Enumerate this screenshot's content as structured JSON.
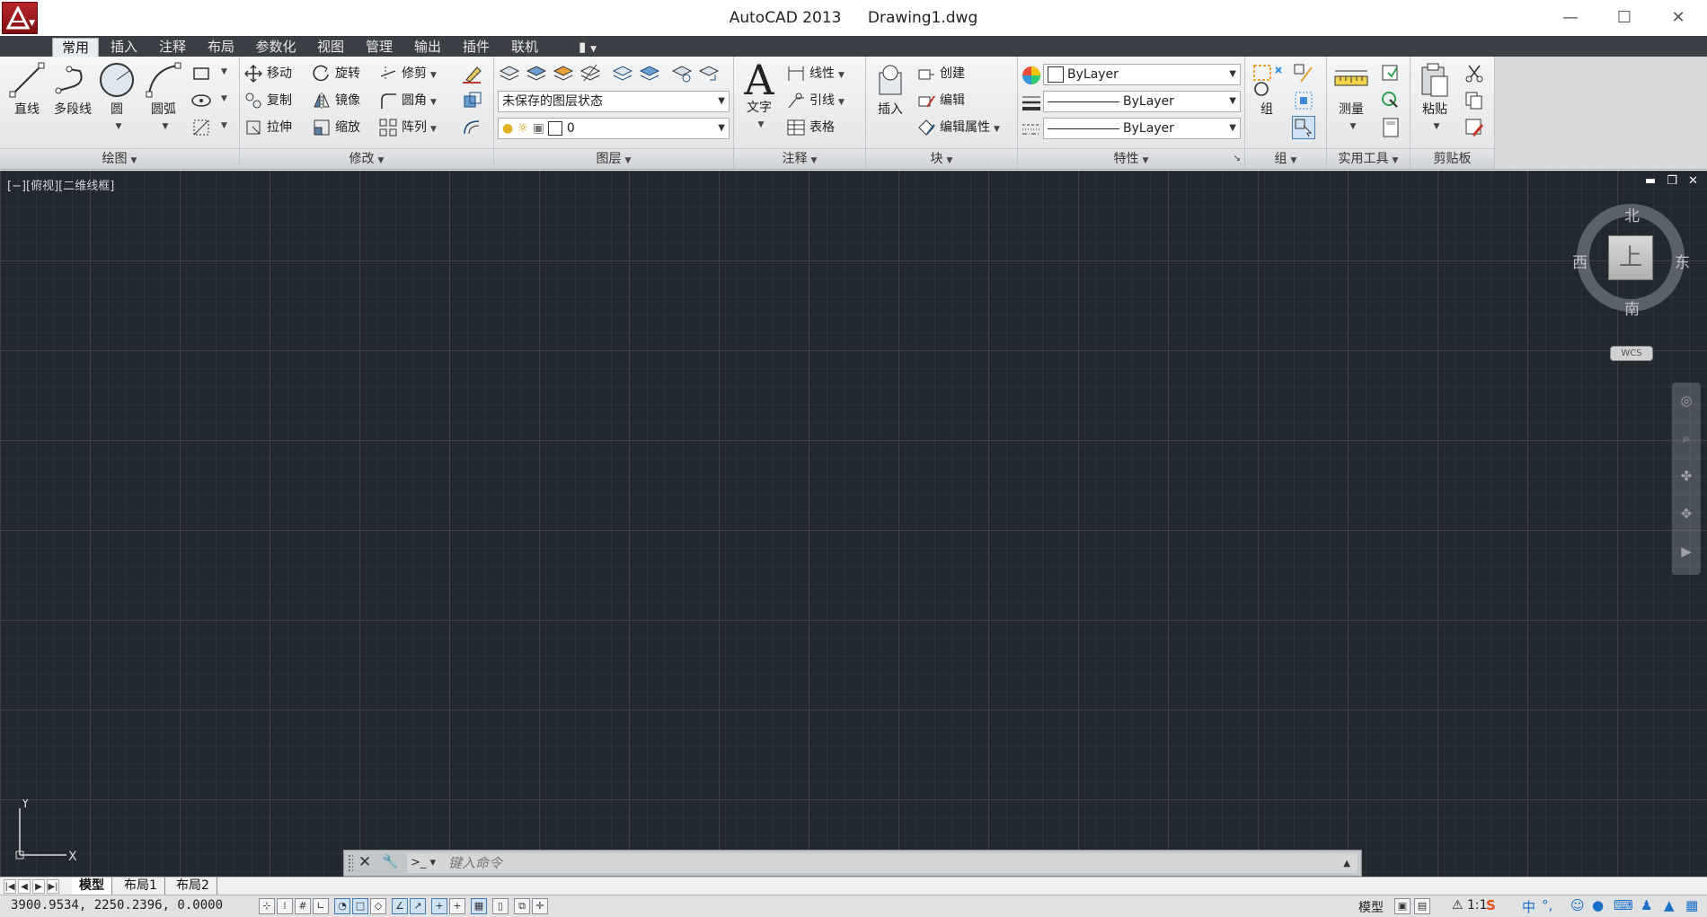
{
  "titlebar": {
    "app": "AutoCAD 2013",
    "file": "Drawing1.dwg"
  },
  "tabs": [
    {
      "label": "常用",
      "active": true
    },
    {
      "label": "插入"
    },
    {
      "label": "注释"
    },
    {
      "label": "布局"
    },
    {
      "label": "参数化"
    },
    {
      "label": "视图"
    },
    {
      "label": "管理"
    },
    {
      "label": "输出"
    },
    {
      "label": "插件"
    },
    {
      "label": "联机"
    }
  ],
  "ribbon": {
    "draw": {
      "title": "绘图",
      "line": "直线",
      "polyline": "多段线",
      "circle": "圆",
      "arc": "圆弧"
    },
    "modify": {
      "title": "修改",
      "move": "移动",
      "rotate": "旋转",
      "trim": "修剪",
      "copy": "复制",
      "mirror": "镜像",
      "fillet": "圆角",
      "stretch": "拉伸",
      "scale": "缩放",
      "array": "阵列"
    },
    "layers": {
      "title": "图层",
      "state": "未保存的图层状态",
      "current": "0"
    },
    "annotation": {
      "title": "注释",
      "text": "文字",
      "linear": "线性",
      "leader": "引线",
      "table": "表格"
    },
    "block": {
      "title": "块",
      "insert": "插入",
      "create": "创建",
      "edit": "编辑",
      "edit_attr": "编辑属性"
    },
    "properties": {
      "title": "特性",
      "color": "ByLayer",
      "lineweight": "ByLayer",
      "linetype": "ByLayer"
    },
    "groups": {
      "title": "组",
      "group": "组"
    },
    "utilities": {
      "title": "实用工具",
      "measure": "测量"
    },
    "clipboard": {
      "title": "剪贴板",
      "paste": "粘贴"
    }
  },
  "viewport": {
    "label": "[−][俯视][二维线框]",
    "viewcube": {
      "north": "北",
      "south": "南",
      "east": "东",
      "west": "西",
      "face": "上",
      "wcs": "WCS"
    },
    "ucs": {
      "x": "X",
      "y": "Y"
    }
  },
  "command": {
    "placeholder": "键入命令"
  },
  "layout_tabs": [
    {
      "label": "模型",
      "active": true
    },
    {
      "label": "布局1"
    },
    {
      "label": "布局2"
    }
  ],
  "status": {
    "coords": "3900.9534,  2250.2396,  0.0000",
    "model": "模型",
    "scale": "1:1"
  },
  "colors": {
    "canvas": "#212830",
    "tabbar": "#3c3f45",
    "brand": "#b9252a"
  }
}
